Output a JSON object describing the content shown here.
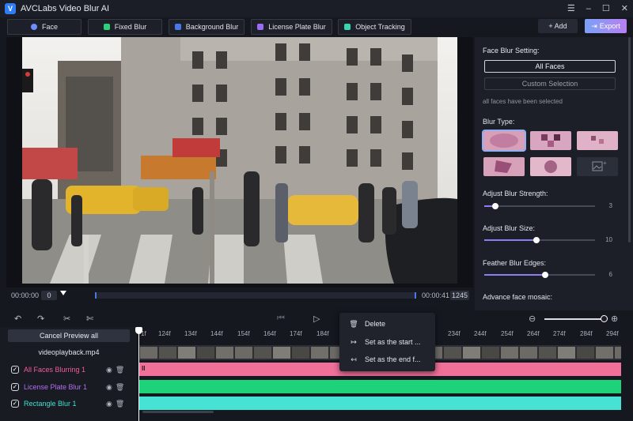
{
  "app": {
    "title": "AVCLabs Video Blur AI",
    "logo_letter": "V"
  },
  "window_controls": {
    "menu": "☰",
    "minimize": "–",
    "maximize": "☐",
    "close": "✕"
  },
  "mode_tabs": [
    {
      "label": "Face",
      "color": "#6f8cff"
    },
    {
      "label": "Fixed Blur",
      "color": "#2ecf7a"
    },
    {
      "label": "Background Blur",
      "color": "#4a78e8"
    },
    {
      "label": "License Plate Blur",
      "color": "#9c6cf0"
    },
    {
      "label": "Object Tracking",
      "color": "#3ad4b0"
    }
  ],
  "toolbar_right": {
    "add_label": "+ Add",
    "export_label": "Export",
    "export_icon": "⇥"
  },
  "player": {
    "current_time": "00:00:00",
    "start_frame": "0",
    "end_time": "00:00:41",
    "end_frame": "1245"
  },
  "panel": {
    "face_blur_setting": "Face Blur Setting:",
    "all_faces": "All Faces",
    "custom_selection": "Custom Selection",
    "status": "all faces have been selected",
    "blur_type": "Blur Type:",
    "blur_strength": {
      "label": "Adjust Blur Strength:",
      "value": "3",
      "level": 0.1
    },
    "blur_size": {
      "label": "Adjust Blur Size:",
      "value": "10",
      "level": 0.47
    },
    "feather": {
      "label": "Feather Blur Edges:",
      "value": "6",
      "level": 0.55
    },
    "advance": "Advance face mosaic:"
  },
  "timeline_tools": {
    "undo": "↶",
    "redo": "↷",
    "split": "✂",
    "cut": "✄",
    "prev": "⏮",
    "play": "▷",
    "zoom_out": "⊖",
    "zoom_in": "⊕",
    "zoom_level": 0.92
  },
  "timeline": {
    "cancel_preview": "Cancel Preview all",
    "video_name": "videoplayback.mp4",
    "ticks": [
      "124f",
      "134f",
      "144f",
      "154f",
      "164f",
      "174f",
      "184f",
      "234f",
      "244f",
      "254f",
      "264f",
      "274f",
      "284f",
      "294f"
    ],
    "ruler_first": "1f",
    "tracks": [
      {
        "name": "All Faces Blurring 1",
        "color": "#f45b9a",
        "bar_color": "#f0709a",
        "checked": "✓",
        "eye": "◉",
        "trash": "🗑"
      },
      {
        "name": "License Plate Blur 1",
        "color": "#b66cf3",
        "bar_color": "#1ed27a",
        "checked": "✓",
        "eye": "◉",
        "trash": "🗑"
      },
      {
        "name": "Rectangle Blur 1",
        "color": "#3fe0d0",
        "bar_color": "#46e2d3",
        "checked": "✓",
        "eye": "◉",
        "trash": "🗑"
      }
    ],
    "pause_icon": "II"
  },
  "context_menu": {
    "items": [
      {
        "label": "Delete",
        "icon": "🗑"
      },
      {
        "label": "Set as the start ...",
        "icon": "↦"
      },
      {
        "label": "Set as the end f...",
        "icon": "↤"
      }
    ]
  }
}
